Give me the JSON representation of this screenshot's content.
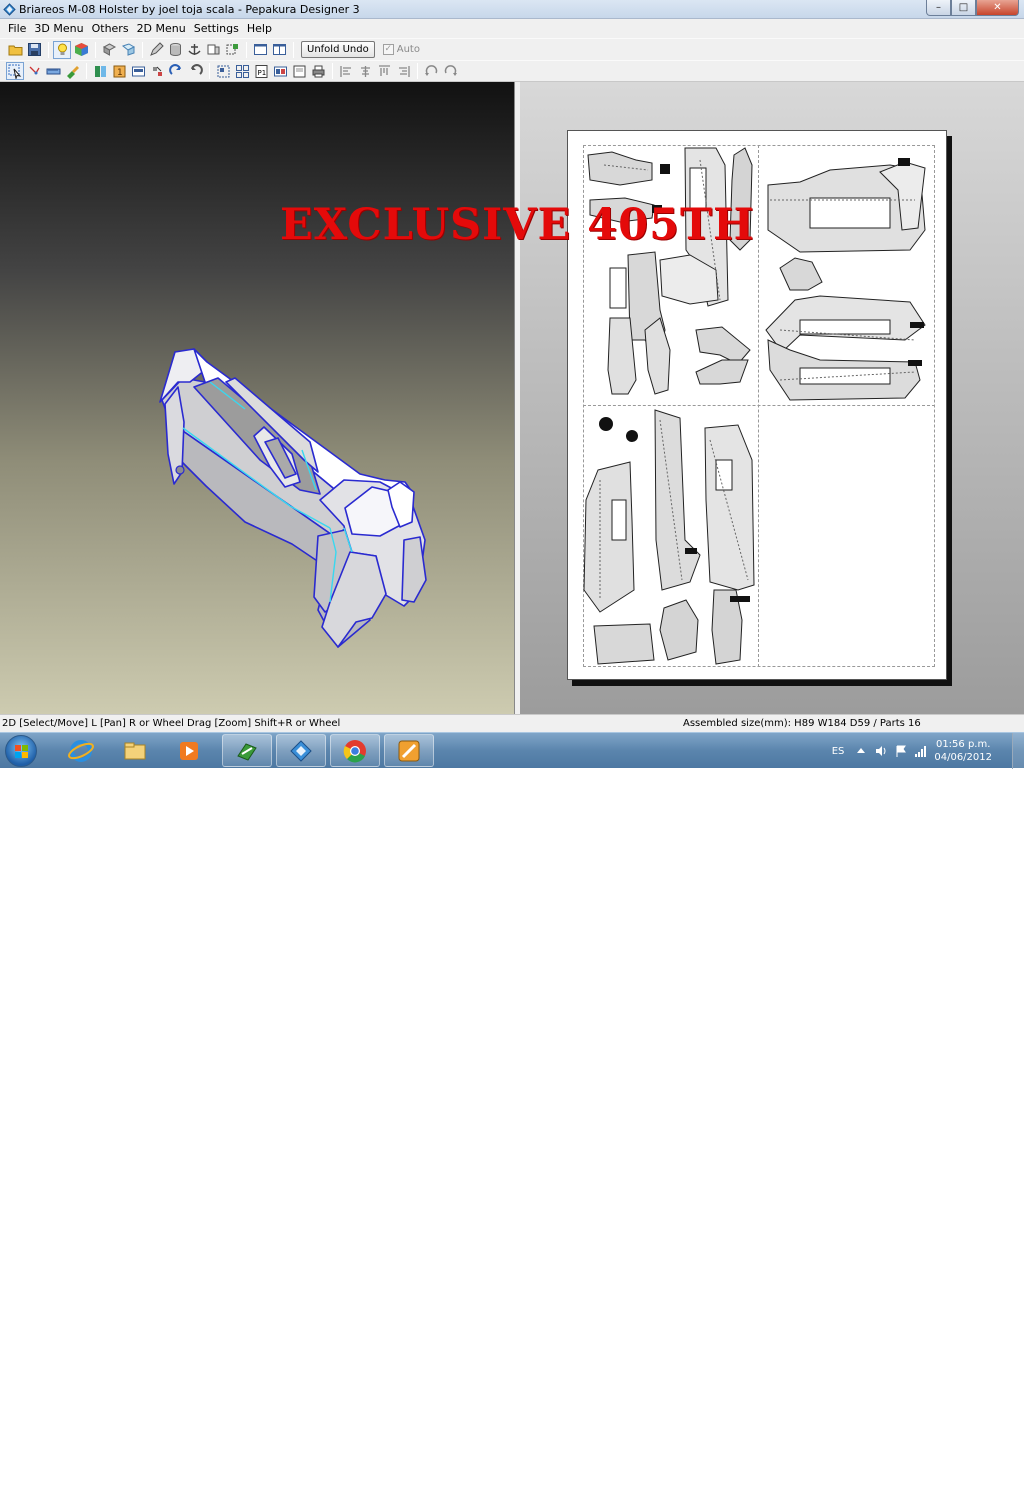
{
  "window": {
    "title": "Briareos M-08 Holster by joel toja scala - Pepakura Designer 3",
    "buttons": [
      "–",
      "□",
      "✕"
    ]
  },
  "menubar": [
    "File",
    "3D Menu",
    "Others",
    "2D Menu",
    "Settings",
    "Help"
  ],
  "toolbar": {
    "unfold_undo_label": "Unfold Undo",
    "auto_label": "Auto",
    "auto_checked": true
  },
  "watermark": "EXCLUSIVE 405TH",
  "status": {
    "left": "2D [Select/Move] L [Pan] R or Wheel Drag [Zoom] Shift+R or Wheel",
    "right": "Assembled size(mm): H89 W184 D59 / Parts 16"
  },
  "taskbar": {
    "items": [
      "start-orb",
      "internet-explorer",
      "file-explorer",
      "media-player",
      "pepakura-unfold",
      "pepakura-designer",
      "chrome",
      "image-editor"
    ],
    "tray_lang": "ES",
    "time": "01:56 p.m.",
    "date": "04/06/2012"
  },
  "colors": {
    "watermark": "#e40a0a",
    "model_edge": "#2a2ad0",
    "model_highlight": "#38d8f0"
  }
}
